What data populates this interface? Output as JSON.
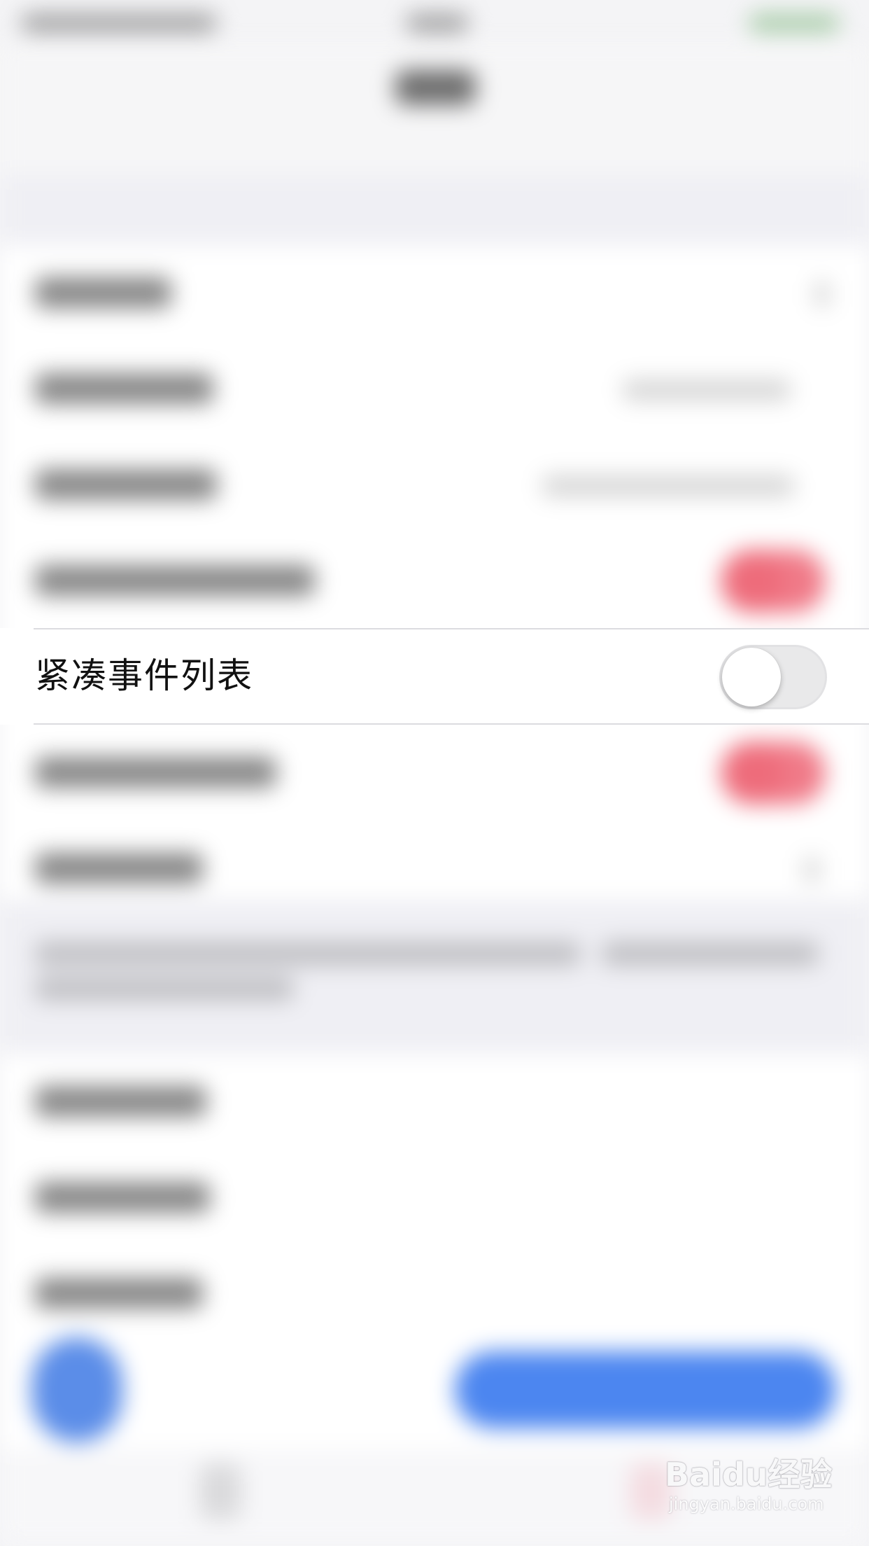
{
  "focused_setting": {
    "label": "紧凑事件列表",
    "toggle_state": "off"
  },
  "watermark": {
    "logo_text": "Baidu经验",
    "sub_text": "jingyan.baidu.com"
  },
  "colors": {
    "toggle_on": "#f07a88",
    "primary_button": "#4c86f0",
    "background": "#efeff4"
  }
}
